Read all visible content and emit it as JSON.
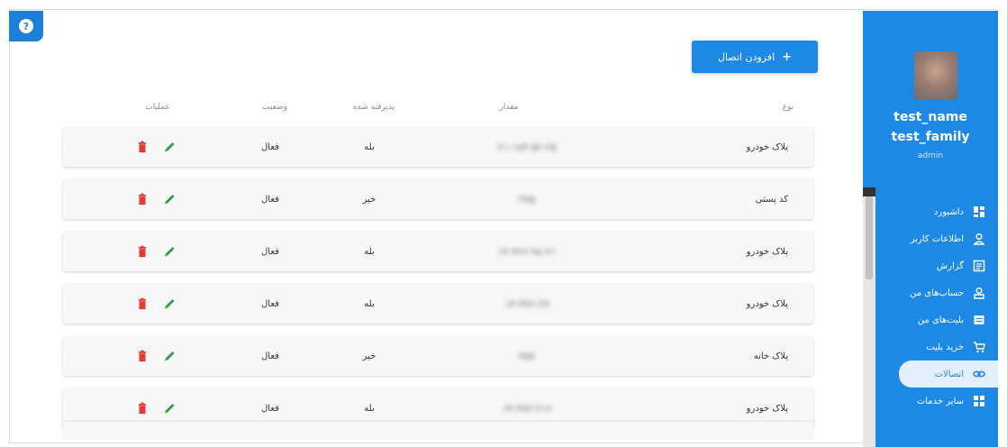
{
  "sidebar": {
    "user_first": "test_name",
    "user_last": "test_family",
    "user_role": "admin",
    "items": [
      {
        "label": "داشبورد",
        "icon": "dashboard-icon"
      },
      {
        "label": "اطلاعات کاربر",
        "icon": "user-icon"
      },
      {
        "label": "گزارش",
        "icon": "report-icon"
      },
      {
        "label": "حساب‌های من",
        "icon": "account-icon"
      },
      {
        "label": "بلیت‌های من",
        "icon": "ticket-icon"
      },
      {
        "label": "خرید بلیت",
        "icon": "cart-icon"
      },
      {
        "label": "اتصالات",
        "icon": "connections-icon",
        "active": true
      },
      {
        "label": "سایر خدمات",
        "icon": "grid-icon"
      }
    ],
    "active_color": "#1e88e5"
  },
  "toolbar": {
    "add_label": "افزودن اتصال",
    "add_icon": "plus-icon"
  },
  "table": {
    "headers": {
      "type": "نوع",
      "value": "مقدار",
      "accepted": "پذیرفته شده",
      "status": "وضعیت",
      "operations": "عملیات"
    },
    "rows": [
      {
        "type": "پلاک خودرو",
        "value": "۲۱-۱۸۳-۵۲-۲۵",
        "accepted": "بله",
        "status": "فعال"
      },
      {
        "type": "کد پستی",
        "value": "۳۷۵",
        "accepted": "خیر",
        "status": "فعال"
      },
      {
        "type": "پلاک خودرو",
        "value": "۱۴-۳۶۶-۹۸-۲۱",
        "accepted": "بله",
        "status": "فعال"
      },
      {
        "type": "پلاک خودرو",
        "value": "۱۴-۳۷۶-۲۷",
        "accepted": "بله",
        "status": "فعال"
      },
      {
        "type": "پلاک خانه",
        "value": "۳۵۷",
        "accepted": "خیر",
        "status": "فعال"
      },
      {
        "type": "پلاک خودرو",
        "value": "۱۴-۳۸۳-۲۱۶",
        "accepted": "بله",
        "status": "فعال"
      }
    ]
  },
  "colors": {
    "primary": "#1e88e5",
    "edit": "#2e9e44",
    "delete": "#e53935"
  }
}
